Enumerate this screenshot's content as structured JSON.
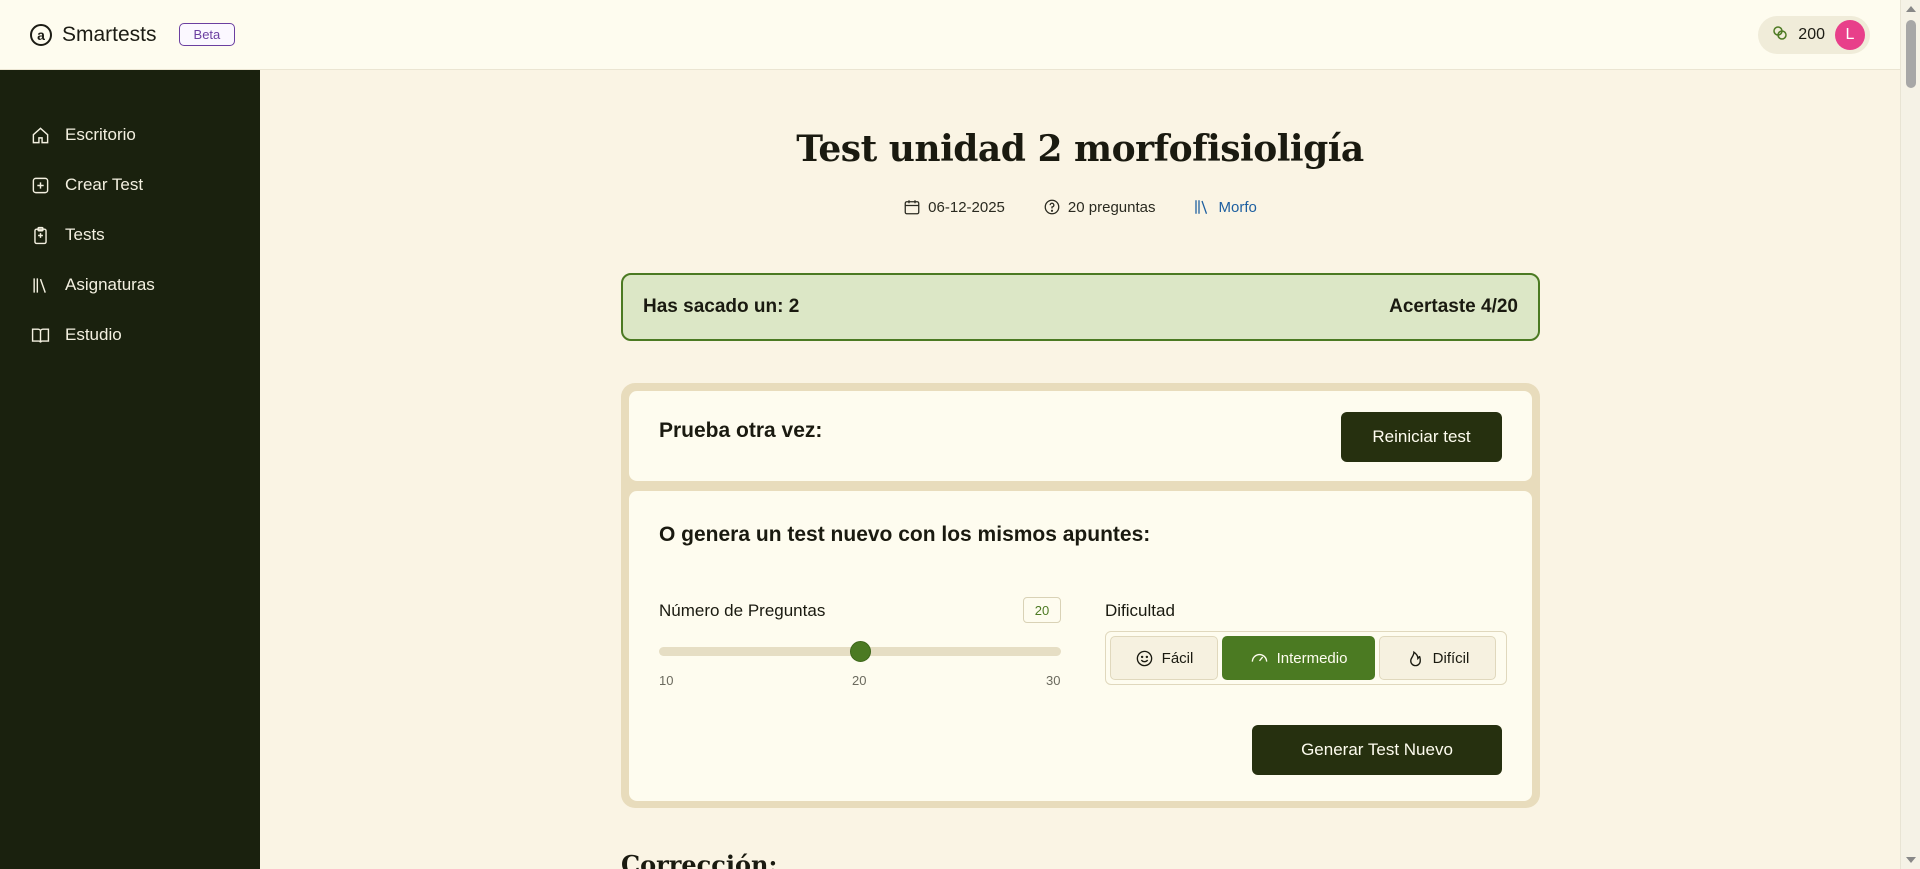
{
  "header": {
    "brand_name": "Smartests",
    "beta_label": "Beta",
    "credits": "200",
    "avatar_initial": "L"
  },
  "sidebar": {
    "items": [
      {
        "label": "Escritorio",
        "icon": "home-icon"
      },
      {
        "label": "Crear Test",
        "icon": "plus-square-icon"
      },
      {
        "label": "Tests",
        "icon": "clipboard-icon"
      },
      {
        "label": "Asignaturas",
        "icon": "library-icon"
      },
      {
        "label": "Estudio",
        "icon": "book-open-icon"
      }
    ]
  },
  "test": {
    "title": "Test unidad 2 morfofisioligía",
    "date": "06-12-2025",
    "questions": "20 preguntas",
    "subject": "Morfo"
  },
  "result": {
    "grade_text": "Has sacado un: 2",
    "correct_text": "Acertaste 4/20"
  },
  "retry": {
    "title": "Prueba otra vez:",
    "restart_label": "Reiniciar test"
  },
  "generate": {
    "title": "O genera un test nuevo con los mismos apuntes:",
    "questions_label": "Número de Preguntas",
    "questions_value": "20",
    "slider": {
      "min": 10,
      "max": 30,
      "value": 20
    },
    "tick_min": "10",
    "tick_mid": "20",
    "tick_max": "30",
    "difficulty_label": "Dificultad",
    "difficulty_options": [
      {
        "label": "Fácil",
        "icon": "smile-icon",
        "active": false
      },
      {
        "label": "Intermedio",
        "icon": "gauge-icon",
        "active": true
      },
      {
        "label": "Difícil",
        "icon": "flame-icon",
        "active": false
      }
    ],
    "generate_label": "Generar Test Nuevo"
  },
  "correction": {
    "title": "Corrección:"
  },
  "colors": {
    "sidebar_bg": "#1a210e",
    "accent_green": "#4b7a22",
    "dark_button": "#26300f",
    "subject_link": "#1d5fa0",
    "avatar_bg": "#e8408a"
  }
}
